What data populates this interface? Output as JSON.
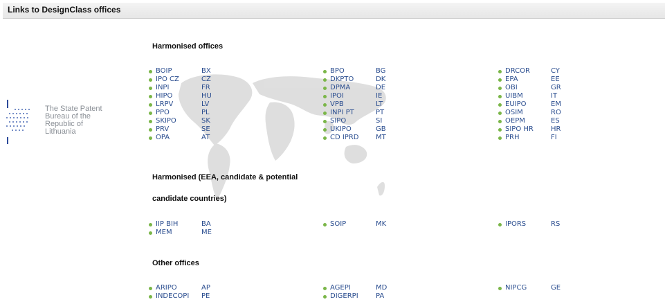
{
  "panel": {
    "title": "Links to DesignClass offices"
  },
  "logo": {
    "lines": [
      "The State Patent",
      "Bureau of the",
      "Republic of",
      "Lithuania"
    ]
  },
  "sections": [
    {
      "heading_lines": [
        "Harmonised offices"
      ],
      "columns": [
        [
          [
            "BOIP",
            "BX"
          ],
          [
            "IPO CZ",
            "CZ"
          ],
          [
            "INPI",
            "FR"
          ],
          [
            "HIPO",
            "HU"
          ],
          [
            "LRPV",
            "LV"
          ],
          [
            "PPO",
            "PL"
          ],
          [
            "SKIPO",
            "SK"
          ],
          [
            "PRV",
            "SE"
          ],
          [
            "OPA",
            "AT"
          ]
        ],
        [
          [
            "BPO",
            "BG"
          ],
          [
            "DKPTO",
            "DK"
          ],
          [
            "DPMA",
            "DE"
          ],
          [
            "IPOI",
            "IE"
          ],
          [
            "VPB",
            "LT"
          ],
          [
            "INPI PT",
            "PT"
          ],
          [
            "SIPO",
            "SI"
          ],
          [
            "UKIPO",
            "GB"
          ],
          [
            "CD IPRD",
            "MT"
          ]
        ],
        [
          [
            "DRCOR",
            "CY"
          ],
          [
            "EPA",
            "EE"
          ],
          [
            "OBI",
            "GR"
          ],
          [
            "UIBM",
            "IT"
          ],
          [
            "EUIPO",
            "EM"
          ],
          [
            "OSIM",
            "RO"
          ],
          [
            "OEPM",
            "ES"
          ],
          [
            "SIPO HR",
            "HR"
          ],
          [
            "PRH",
            "FI"
          ]
        ]
      ]
    },
    {
      "heading_lines": [
        "Harmonised (EEA, candidate & potential",
        "candidate countries)"
      ],
      "columns": [
        [
          [
            "IIP BIH",
            "BA"
          ],
          [
            "MEM",
            "ME"
          ]
        ],
        [
          [
            "SOIP",
            "MK"
          ]
        ],
        [
          [
            "IPORS",
            "RS"
          ]
        ]
      ]
    },
    {
      "heading_lines": [
        "Other offices"
      ],
      "columns": [
        [
          [
            "ARIPO",
            "AP"
          ],
          [
            "INDECOPI",
            "PE"
          ]
        ],
        [
          [
            "AGEPI",
            "MD"
          ],
          [
            "DIGERPI",
            "PA"
          ]
        ],
        [
          [
            "NIPCG",
            "GE"
          ]
        ]
      ]
    }
  ]
}
